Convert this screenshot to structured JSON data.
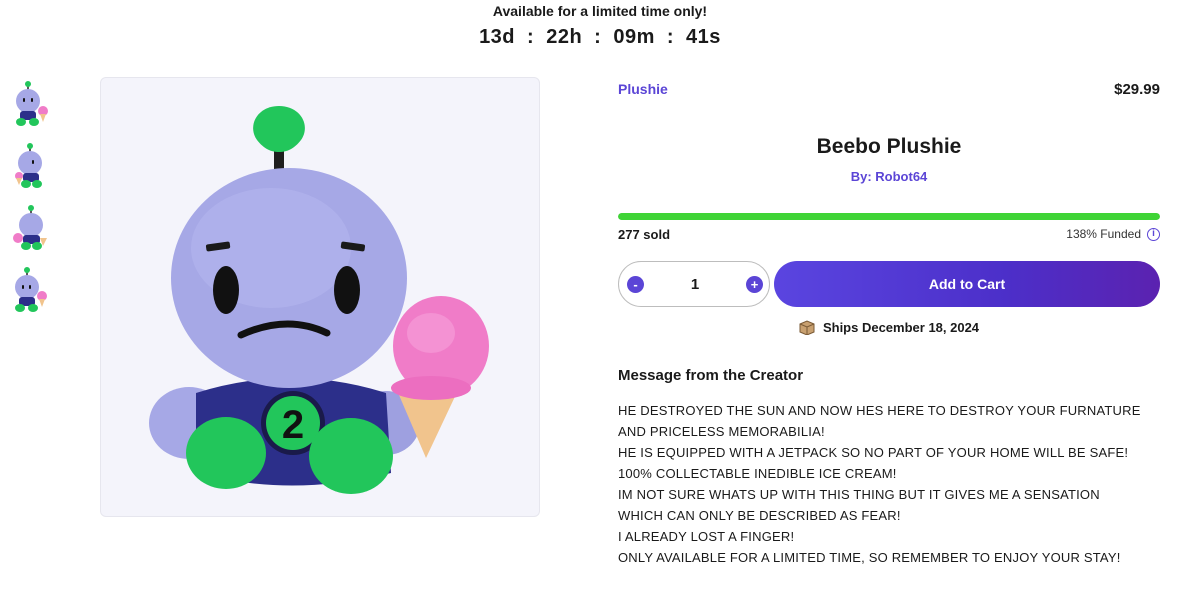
{
  "banner": {
    "title": "Available for a limited time only!",
    "countdown": {
      "days": "13d",
      "hours": "22h",
      "minutes": "09m",
      "seconds": "41s",
      "separator": ":"
    }
  },
  "gallery": {
    "thumbnails": [
      "beebo-thumb-front",
      "beebo-thumb-side",
      "beebo-thumb-back",
      "beebo-thumb-angle"
    ],
    "main_image": "beebo-plushie-photo"
  },
  "product": {
    "category": "Plushie",
    "price": "$29.99",
    "title": "Beebo Plushie",
    "byline": "By: Robot64",
    "sold": "277 sold",
    "funded_label": "138% Funded",
    "funded_percent": 138,
    "progress_fraction": 1.0,
    "info_glyph": "i"
  },
  "cart": {
    "quantity": "1",
    "minus": "-",
    "plus": "+",
    "add_label": "Add to Cart"
  },
  "shipping": {
    "label": "Ships December 18, 2024"
  },
  "creator_message": {
    "title": "Message from the Creator",
    "lines": [
      "HE DESTROYED THE SUN AND NOW HES HERE TO DESTROY YOUR FURNATURE",
      "AND PRICELESS MEMORABILIA!",
      "HE IS EQUIPPED WITH A JETPACK SO NO PART OF YOUR HOME WILL BE SAFE!",
      "100% COLLECTABLE INEDIBLE ICE CREAM!",
      "IM NOT SURE WHATS UP WITH THIS THING BUT IT GIVES ME A SENSATION",
      "WHICH CAN ONLY BE DESCRIBED AS FEAR!",
      "I ALREADY LOST A FINGER!",
      "ONLY AVAILABLE FOR A LIMITED TIME, SO REMEMBER TO ENJOY YOUR STAY!"
    ]
  },
  "colors": {
    "accent": "#5b45d6",
    "progress": "#3fd436",
    "plush_body": "#a6a8e6",
    "plush_green": "#22c65b",
    "plush_shirt": "#2c2f8a",
    "icecream_pink": "#f07cc8",
    "cone": "#f1c48d"
  }
}
